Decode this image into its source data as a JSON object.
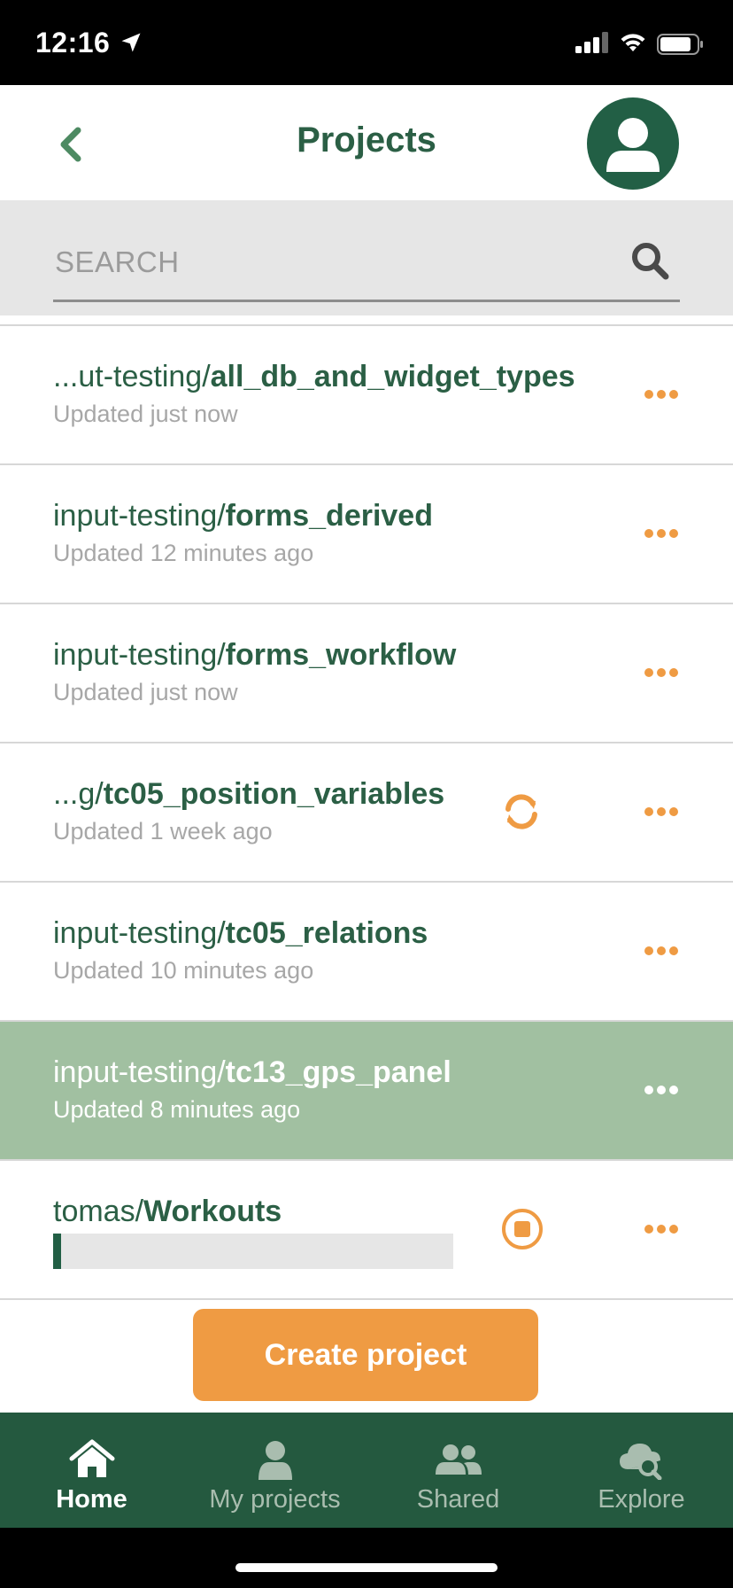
{
  "status_bar": {
    "time": "12:16",
    "icons": [
      "location-arrow-icon",
      "cellular-signal-icon",
      "wifi-icon",
      "battery-icon"
    ]
  },
  "header": {
    "title": "Projects",
    "back_icon": "chevron-left-icon",
    "avatar_icon": "user-icon"
  },
  "search": {
    "placeholder": "SEARCH",
    "value": "",
    "icon": "search-icon"
  },
  "projects": [
    {
      "namespace": "...ut-testing/",
      "name": "all_db_and_widget_types",
      "updated": "Updated just now",
      "selected": false
    },
    {
      "namespace": "input-testing/",
      "name": "forms_derived",
      "updated": "Updated 12 minutes ago",
      "selected": false
    },
    {
      "namespace": "input-testing/",
      "name": "forms_workflow",
      "updated": "Updated just now",
      "selected": false
    },
    {
      "namespace": "...g/",
      "name": "tc05_position_variables",
      "updated": "Updated 1 week ago",
      "selected": false,
      "status_icon": "sync-icon"
    },
    {
      "namespace": "input-testing/",
      "name": "tc05_relations",
      "updated": "Updated 10 minutes ago",
      "selected": false
    },
    {
      "namespace": "input-testing/",
      "name": "tc13_gps_panel",
      "updated": "Updated 8 minutes ago",
      "selected": true
    },
    {
      "namespace": "tomas/",
      "name": "Workouts",
      "selected": false,
      "status_icon": "stop-icon",
      "progress": 0.02
    }
  ],
  "create_project_label": "Create project",
  "bottom_nav": [
    {
      "label": "Home",
      "icon": "home-icon",
      "active": true
    },
    {
      "label": "My projects",
      "icon": "user-icon",
      "active": false
    },
    {
      "label": "Shared",
      "icon": "users-icon",
      "active": false
    },
    {
      "label": "Explore",
      "icon": "cloud-search-icon",
      "active": false
    }
  ],
  "colors": {
    "brand_green": "#2b5f45",
    "nav_green": "#24593f",
    "accent_orange": "#ef9b43",
    "selected_row": "#a1c0a1"
  }
}
